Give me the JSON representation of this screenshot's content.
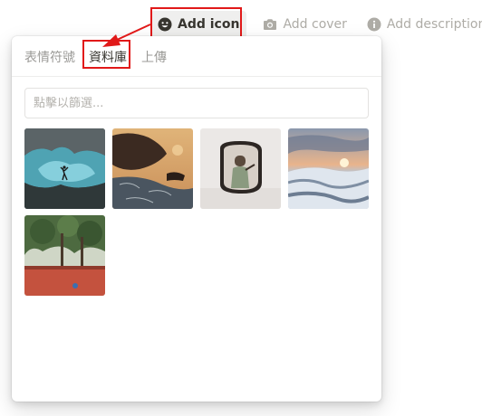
{
  "toolbar": {
    "add_icon": "Add icon",
    "add_cover": "Add cover",
    "add_description": "Add description"
  },
  "icon_picker": {
    "tabs": [
      "表情符號",
      "資料庫",
      "上傳"
    ],
    "active_tab": "資料庫",
    "search_placeholder": "點擊以篩選..."
  },
  "library_images": [
    {
      "subject": "glacier ice cave with person"
    },
    {
      "subject": "coastal rocks at sunset"
    },
    {
      "subject": "mirror selfie in white room"
    },
    {
      "subject": "snowy mountains at sunrise"
    },
    {
      "subject": "tropical trees over red wall"
    }
  ],
  "annotation": {
    "highlight_color": "#e11919"
  },
  "icons": [
    "smiley-icon",
    "camera-icon",
    "info-icon"
  ]
}
